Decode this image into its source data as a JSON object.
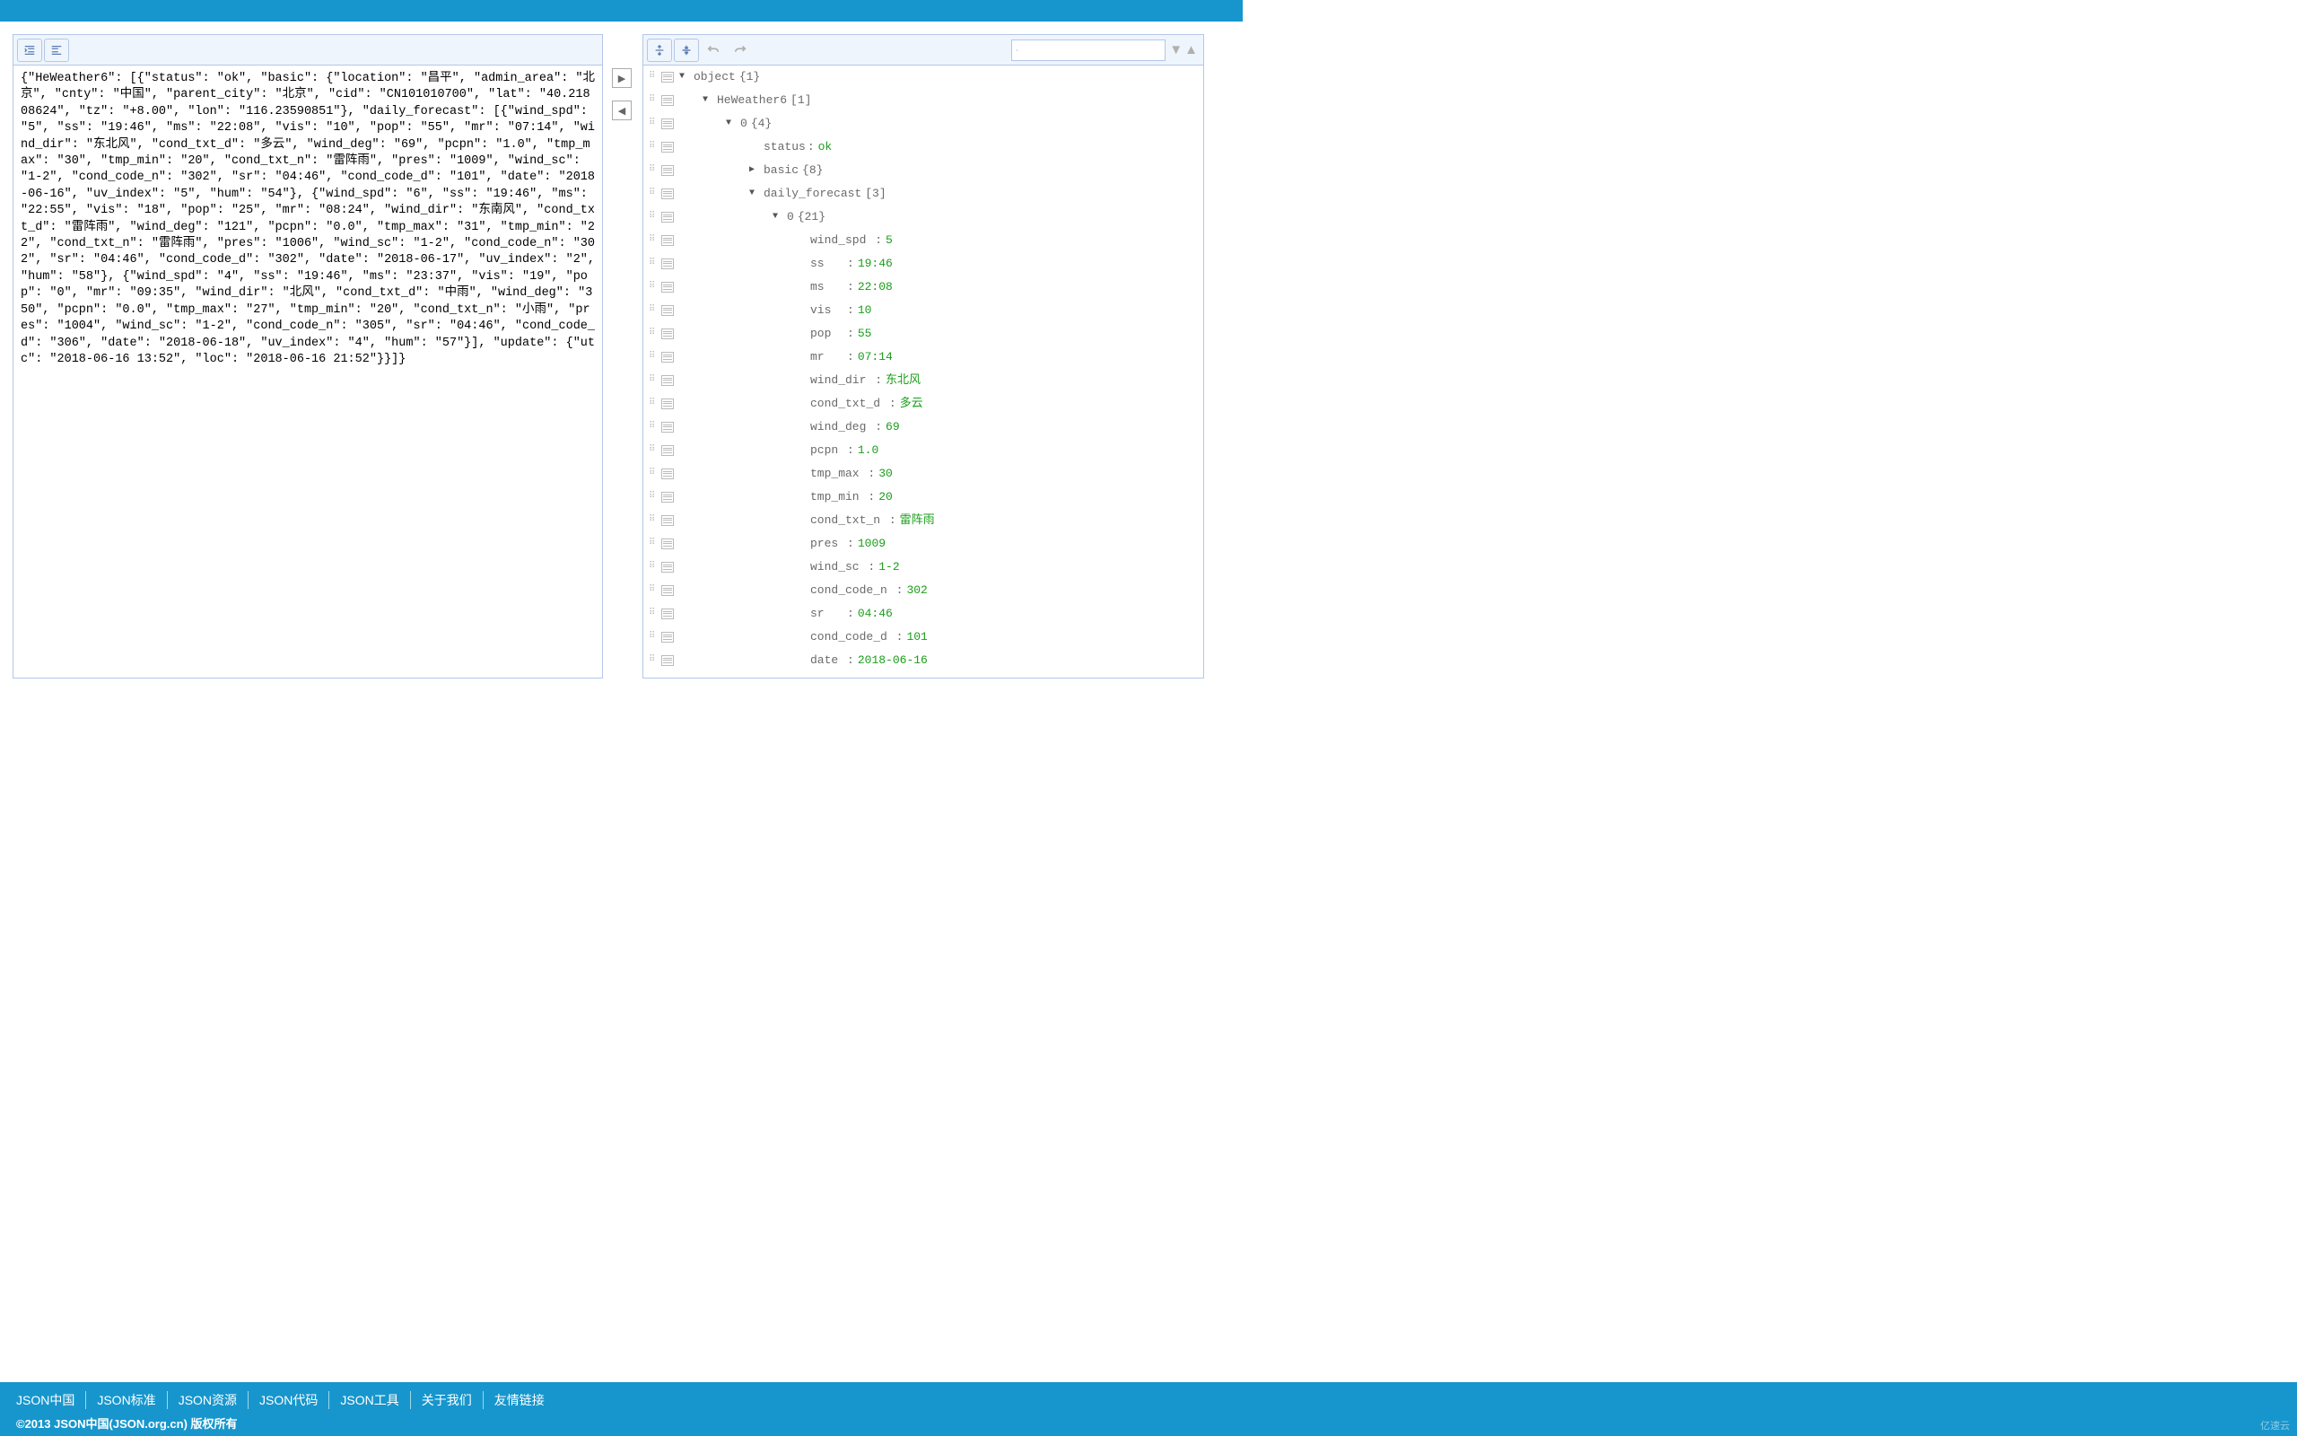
{
  "footer": {
    "links": [
      "JSON中国",
      "JSON标准",
      "JSON资源",
      "JSON代码",
      "JSON工具",
      "关于我们",
      "友情链接"
    ],
    "copyright": "©2013 JSON中国(JSON.org.cn) 版权所有"
  },
  "watermark": "亿速云",
  "raw_json_text": "{\"HeWeather6\": [{\"status\": \"ok\", \"basic\": {\"location\": \"昌平\", \"admin_area\": \"北京\", \"cnty\": \"中国\", \"parent_city\": \"北京\", \"cid\": \"CN101010700\", \"lat\": \"40.21808624\", \"tz\": \"+8.00\", \"lon\": \"116.23590851\"}, \"daily_forecast\": [{\"wind_spd\": \"5\", \"ss\": \"19:46\", \"ms\": \"22:08\", \"vis\": \"10\", \"pop\": \"55\", \"mr\": \"07:14\", \"wind_dir\": \"东北风\", \"cond_txt_d\": \"多云\", \"wind_deg\": \"69\", \"pcpn\": \"1.0\", \"tmp_max\": \"30\", \"tmp_min\": \"20\", \"cond_txt_n\": \"雷阵雨\", \"pres\": \"1009\", \"wind_sc\": \"1-2\", \"cond_code_n\": \"302\", \"sr\": \"04:46\", \"cond_code_d\": \"101\", \"date\": \"2018-06-16\", \"uv_index\": \"5\", \"hum\": \"54\"}, {\"wind_spd\": \"6\", \"ss\": \"19:46\", \"ms\": \"22:55\", \"vis\": \"18\", \"pop\": \"25\", \"mr\": \"08:24\", \"wind_dir\": \"东南风\", \"cond_txt_d\": \"雷阵雨\", \"wind_deg\": \"121\", \"pcpn\": \"0.0\", \"tmp_max\": \"31\", \"tmp_min\": \"22\", \"cond_txt_n\": \"雷阵雨\", \"pres\": \"1006\", \"wind_sc\": \"1-2\", \"cond_code_n\": \"302\", \"sr\": \"04:46\", \"cond_code_d\": \"302\", \"date\": \"2018-06-17\", \"uv_index\": \"2\", \"hum\": \"58\"}, {\"wind_spd\": \"4\", \"ss\": \"19:46\", \"ms\": \"23:37\", \"vis\": \"19\", \"pop\": \"0\", \"mr\": \"09:35\", \"wind_dir\": \"北风\", \"cond_txt_d\": \"中雨\", \"wind_deg\": \"350\", \"pcpn\": \"0.0\", \"tmp_max\": \"27\", \"tmp_min\": \"20\", \"cond_txt_n\": \"小雨\", \"pres\": \"1004\", \"wind_sc\": \"1-2\", \"cond_code_n\": \"305\", \"sr\": \"04:46\", \"cond_code_d\": \"306\", \"date\": \"2018-06-18\", \"uv_index\": \"4\", \"hum\": \"57\"}], \"update\": {\"utc\": \"2018-06-16 13:52\", \"loc\": \"2018-06-16 21:52\"}}]}",
  "tree": [
    {
      "indent": 0,
      "toggle": "down",
      "key": "object",
      "meta": "{1}",
      "sep": ""
    },
    {
      "indent": 1,
      "toggle": "down",
      "key": "HeWeather6",
      "meta": "[1]",
      "sep": ""
    },
    {
      "indent": 2,
      "toggle": "down",
      "key": "0",
      "meta": "{4}",
      "sep": ""
    },
    {
      "indent": 3,
      "toggle": "none",
      "key": "status",
      "sep": ":",
      "val": "ok",
      "vt": "str"
    },
    {
      "indent": 3,
      "toggle": "right",
      "key": "basic",
      "meta": "{8}",
      "sep": ""
    },
    {
      "indent": 3,
      "toggle": "down",
      "key": "daily_forecast",
      "meta": "[3]",
      "sep": ""
    },
    {
      "indent": 4,
      "toggle": "down",
      "key": "0",
      "meta": "{21}",
      "sep": ""
    },
    {
      "indent": 5,
      "toggle": "none",
      "key": "wind_spd",
      "sep": ":",
      "val": "5",
      "vt": "str",
      "pad": " "
    },
    {
      "indent": 5,
      "toggle": "none",
      "key": "ss",
      "sep": ":",
      "val": "19:46",
      "vt": "str",
      "pad": "   "
    },
    {
      "indent": 5,
      "toggle": "none",
      "key": "ms",
      "sep": ":",
      "val": "22:08",
      "vt": "str",
      "pad": "   "
    },
    {
      "indent": 5,
      "toggle": "none",
      "key": "vis",
      "sep": ":",
      "val": "10",
      "vt": "str",
      "pad": "  "
    },
    {
      "indent": 5,
      "toggle": "none",
      "key": "pop",
      "sep": ":",
      "val": "55",
      "vt": "str",
      "pad": "  "
    },
    {
      "indent": 5,
      "toggle": "none",
      "key": "mr",
      "sep": ":",
      "val": "07:14",
      "vt": "str",
      "pad": "   "
    },
    {
      "indent": 5,
      "toggle": "none",
      "key": "wind_dir",
      "sep": ":",
      "val": "东北风",
      "vt": "str",
      "pad": " "
    },
    {
      "indent": 5,
      "toggle": "none",
      "key": "cond_txt_d",
      "sep": ":",
      "val": "多云",
      "vt": "str",
      "pad": " "
    },
    {
      "indent": 5,
      "toggle": "none",
      "key": "wind_deg",
      "sep": ":",
      "val": "69",
      "vt": "str",
      "pad": " "
    },
    {
      "indent": 5,
      "toggle": "none",
      "key": "pcpn",
      "sep": ":",
      "val": "1.0",
      "vt": "str",
      "pad": " "
    },
    {
      "indent": 5,
      "toggle": "none",
      "key": "tmp_max",
      "sep": ":",
      "val": "30",
      "vt": "str",
      "pad": " "
    },
    {
      "indent": 5,
      "toggle": "none",
      "key": "tmp_min",
      "sep": ":",
      "val": "20",
      "vt": "str",
      "pad": " "
    },
    {
      "indent": 5,
      "toggle": "none",
      "key": "cond_txt_n",
      "sep": ":",
      "val": "雷阵雨",
      "vt": "str",
      "pad": " "
    },
    {
      "indent": 5,
      "toggle": "none",
      "key": "pres",
      "sep": ":",
      "val": "1009",
      "vt": "str",
      "pad": " "
    },
    {
      "indent": 5,
      "toggle": "none",
      "key": "wind_sc",
      "sep": ":",
      "val": "1-2",
      "vt": "str",
      "pad": " "
    },
    {
      "indent": 5,
      "toggle": "none",
      "key": "cond_code_n",
      "sep": ":",
      "val": "302",
      "vt": "str",
      "pad": " "
    },
    {
      "indent": 5,
      "toggle": "none",
      "key": "sr",
      "sep": ":",
      "val": "04:46",
      "vt": "str",
      "pad": "   "
    },
    {
      "indent": 5,
      "toggle": "none",
      "key": "cond_code_d",
      "sep": ":",
      "val": "101",
      "vt": "str",
      "pad": " "
    },
    {
      "indent": 5,
      "toggle": "none",
      "key": "date",
      "sep": ":",
      "val": "2018-06-16",
      "vt": "str",
      "pad": " "
    }
  ]
}
